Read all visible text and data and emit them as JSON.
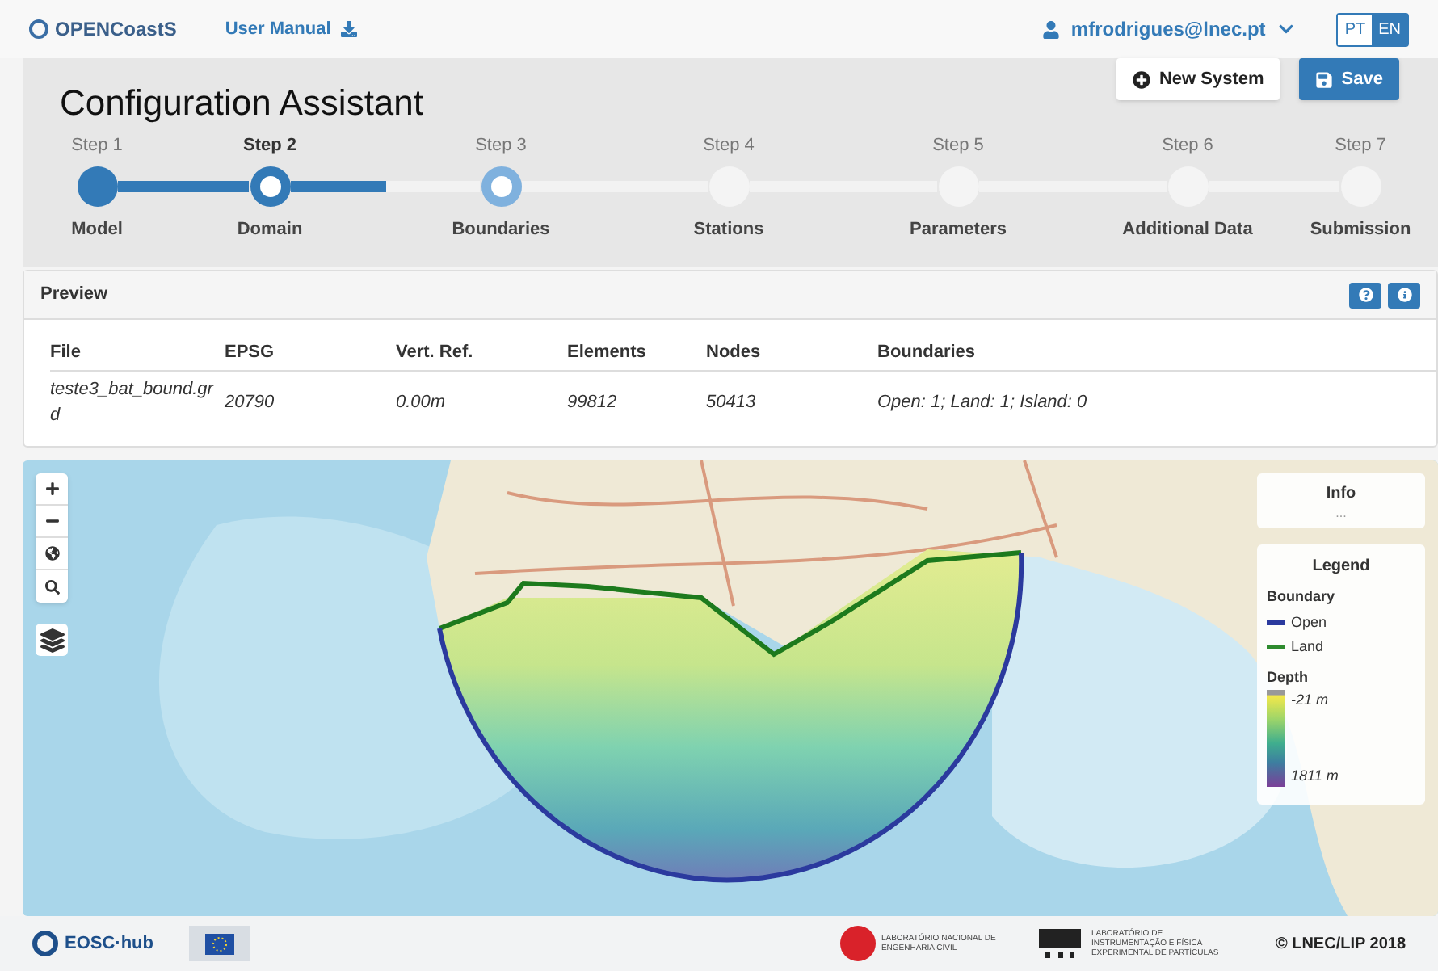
{
  "navbar": {
    "brand": "OPENCoastS",
    "manual_link": "User Manual",
    "user": "mfrodrigues@lnec.pt",
    "languages": [
      {
        "label": "PT",
        "selected": false
      },
      {
        "label": "EN",
        "selected": true
      }
    ]
  },
  "assistant": {
    "title": "Configuration Assistant",
    "buttons": [
      {
        "label": "New System",
        "kind": "secondary"
      },
      {
        "label": "Save",
        "kind": "primary"
      }
    ],
    "steps": [
      {
        "step": "Step 1",
        "label": "Model",
        "kind": "done"
      },
      {
        "step": "Step 2",
        "label": "Domain",
        "kind": "current"
      },
      {
        "step": "Step 3",
        "label": "Boundaries",
        "kind": "next"
      },
      {
        "step": "Step 4",
        "label": "Stations",
        "kind": "pending"
      },
      {
        "step": "Step 5",
        "label": "Parameters",
        "kind": "pending"
      },
      {
        "step": "Step 6",
        "label": "Additional Data",
        "kind": "pending"
      },
      {
        "step": "Step 7",
        "label": "Submission",
        "kind": "pending"
      }
    ]
  },
  "preview": {
    "title": "Preview",
    "table": {
      "columns": [
        "File",
        "EPSG",
        "Vert. Ref.",
        "Elements",
        "Nodes",
        "Boundaries"
      ],
      "rows": [
        [
          "teste3_bat_bound.grd",
          "20790",
          "0.00m",
          "99812",
          "50413",
          "Open: 1; Land: 1; Island: 0"
        ]
      ]
    }
  },
  "map": {
    "kind": "picture",
    "info": {
      "title": "Info",
      "text": "..."
    },
    "legend": {
      "title": "Legend",
      "boundary_title": "Boundary",
      "boundaries": [
        {
          "label": "Open",
          "color": "#2b3a9e"
        },
        {
          "label": "Land",
          "color": "#2e8b2e"
        }
      ],
      "depth_title": "Depth",
      "depth_min": "-21 m",
      "depth_max": "1811 m"
    }
  },
  "footer": {
    "eosc": "EOSC·hub",
    "lnec": "LABORATÓRIO NACIONAL DE ENGENHARIA CIVIL",
    "lip": "LABORATÓRIO DE INSTRUMENTAÇÃO E FÍSICA EXPERIMENTAL DE PARTÍCULAS",
    "copyright": "© LNEC/LIP 2018"
  }
}
